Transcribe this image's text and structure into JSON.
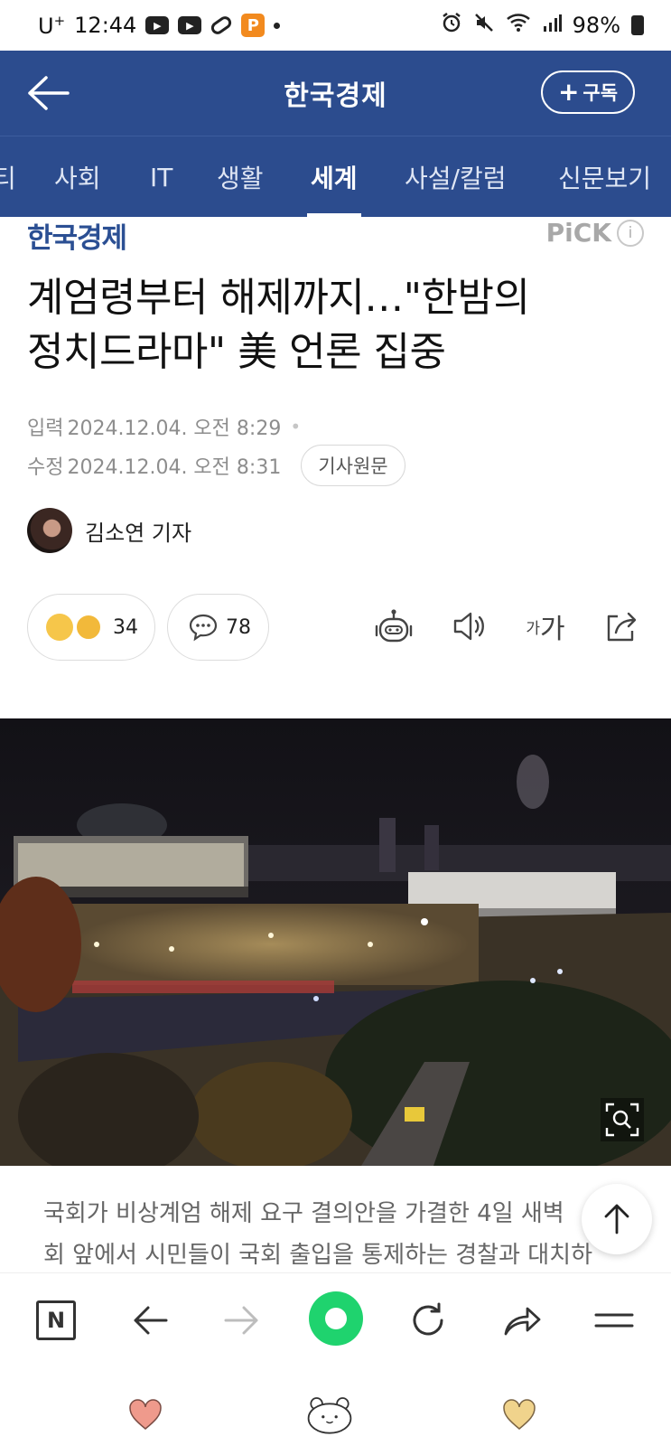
{
  "status_bar": {
    "carrier": "U",
    "carrier_sup": "+",
    "time": "12:44",
    "badge_p": "P",
    "battery": "98%"
  },
  "header": {
    "title": "한국경제",
    "subscribe_label": "구독",
    "subscribe_plus": "+"
  },
  "tabs": [
    {
      "label": "티"
    },
    {
      "label": "사회"
    },
    {
      "label": "IT"
    },
    {
      "label": "생활"
    },
    {
      "label": "세계"
    },
    {
      "label": "사설/칼럼"
    },
    {
      "label": "신문보기"
    }
  ],
  "active_tab": "세계",
  "article": {
    "brand": "한국경제",
    "pick": "PiCK",
    "pick_info": "i",
    "headline_line1": "계엄령부터 해제까지…\"한밤의",
    "headline_line2": "정치드라마\" 美 언론 집중",
    "input_label": "입력",
    "input_time": "2024.12.04. 오전 8:29",
    "edit_label": "수정",
    "edit_time": "2024.12.04. 오전 8:31",
    "source_button": "기사원문",
    "author": "김소연 기자",
    "reaction_count": "34",
    "comment_count": "78",
    "font_small": "가",
    "font_large": "가",
    "caption_line1": "국회가 비상계엄 해제 요구 결의안을 가결한 4일 새벽",
    "caption_line2": "회 앞에서 시민들이 국회 출입을 통제하는 경찰과 대치하"
  },
  "browser": {
    "n_label": "N"
  },
  "colors": {
    "header_bg": "#2c4c8e",
    "brand_blue": "#2b4f93",
    "green": "#1fd36e"
  }
}
